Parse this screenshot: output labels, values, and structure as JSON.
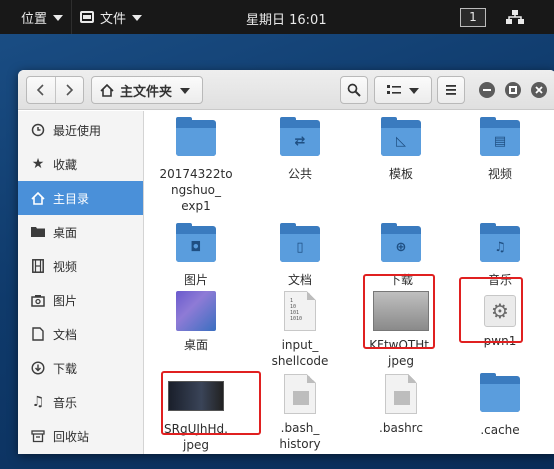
{
  "topbar": {
    "places_label": "位置",
    "files_label": "文件",
    "clock": "星期日 16:01",
    "workspace": "1"
  },
  "toolbar": {
    "location_label": "主文件夹"
  },
  "sidebar": {
    "items": [
      {
        "label": "最近使用",
        "icon": "clock-icon"
      },
      {
        "label": "收藏",
        "icon": "star-icon"
      },
      {
        "label": "主目录",
        "icon": "home-icon"
      },
      {
        "label": "桌面",
        "icon": "folder-icon"
      },
      {
        "label": "视频",
        "icon": "film-icon"
      },
      {
        "label": "图片",
        "icon": "image-icon"
      },
      {
        "label": "文档",
        "icon": "document-icon"
      },
      {
        "label": "下载",
        "icon": "download-icon"
      },
      {
        "label": "音乐",
        "icon": "music-icon"
      },
      {
        "label": "回收站",
        "icon": "trash-icon"
      }
    ]
  },
  "files": [
    {
      "name": "20174322to\nngshuo_\nexp1",
      "kind": "folder"
    },
    {
      "name": "公共",
      "kind": "folder-share"
    },
    {
      "name": "模板",
      "kind": "folder-template"
    },
    {
      "name": "视频",
      "kind": "folder-video"
    },
    {
      "name": "图片",
      "kind": "folder-pictures"
    },
    {
      "name": "文档",
      "kind": "folder-documents"
    },
    {
      "name": "下载",
      "kind": "folder-download"
    },
    {
      "name": "音乐",
      "kind": "folder-music"
    },
    {
      "name": "桌面",
      "kind": "desktop"
    },
    {
      "name": "input_\nshellcode",
      "kind": "binary"
    },
    {
      "name": "KFtwOTHt.\njpeg",
      "kind": "image-gray"
    },
    {
      "name": "pwn1",
      "kind": "executable"
    },
    {
      "name": "SRgUJhHd.\njpeg",
      "kind": "image-dark"
    },
    {
      "name": ".bash_\nhistory",
      "kind": "text"
    },
    {
      "name": ".bashrc",
      "kind": "text"
    },
    {
      "name": ".cache",
      "kind": "folder"
    }
  ],
  "colors": {
    "accent": "#4a90d9",
    "folder": "#3a7bbf",
    "highlight_box": "#e02020"
  }
}
